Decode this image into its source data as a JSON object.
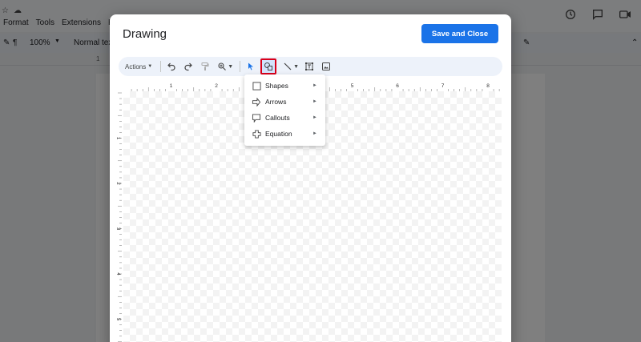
{
  "background_app": {
    "menus": [
      "Format",
      "Tools",
      "Extensions",
      "He"
    ],
    "zoom": "100%",
    "style": "Normal tex",
    "ruler_mark": "1"
  },
  "dialog": {
    "title": "Drawing",
    "save_label": "Save and Close"
  },
  "toolbar": {
    "actions_label": "Actions"
  },
  "ruler": {
    "horizontal": [
      "1",
      "2",
      "3",
      "4",
      "5",
      "6",
      "7",
      "8"
    ],
    "vertical": [
      "1",
      "2",
      "3",
      "4",
      "5"
    ]
  },
  "shape_menu": {
    "items": [
      {
        "label": "Shapes",
        "icon": "square-icon"
      },
      {
        "label": "Arrows",
        "icon": "arrow-right-icon"
      },
      {
        "label": "Callouts",
        "icon": "callout-icon"
      },
      {
        "label": "Equation",
        "icon": "plus-outline-icon"
      }
    ]
  }
}
